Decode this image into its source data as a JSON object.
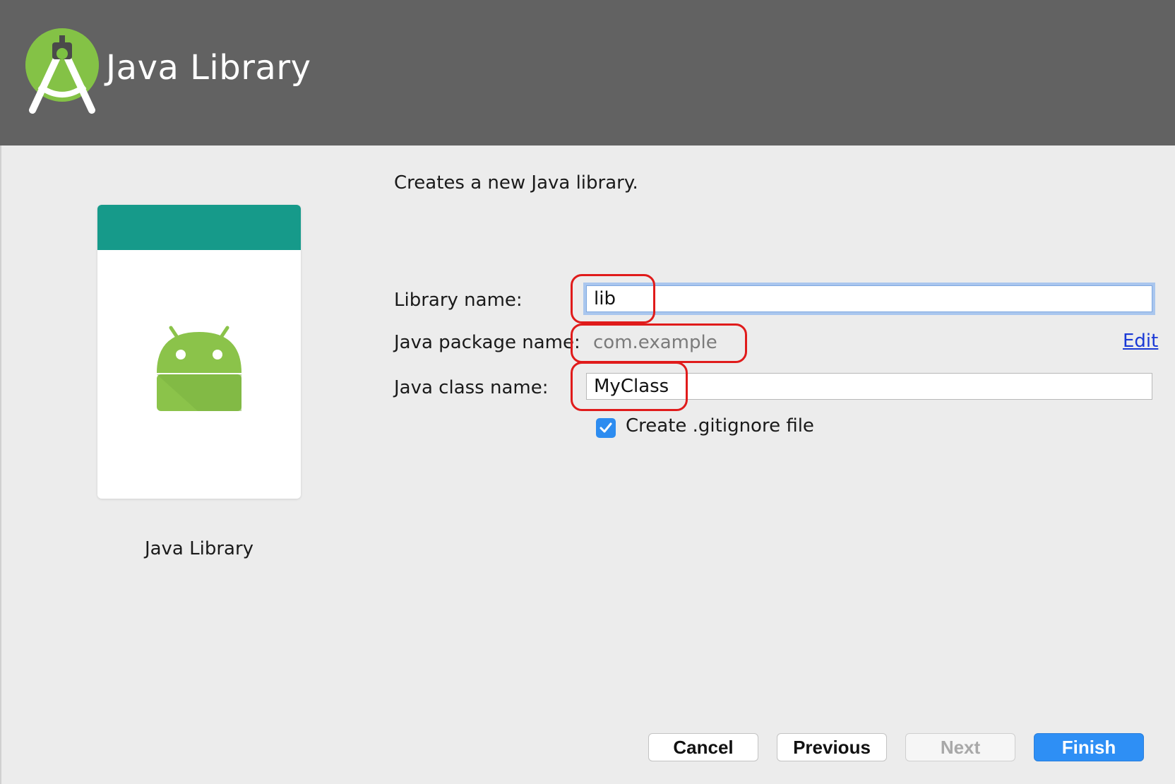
{
  "header": {
    "title": "Java Library",
    "logo_icon": "android-studio-logo-icon"
  },
  "preview": {
    "label": "Java Library",
    "icon": "android-robot-icon",
    "bar_color": "#169a8a"
  },
  "form": {
    "description": "Creates a new Java library.",
    "library_name": {
      "label": "Library name:",
      "value": "lib"
    },
    "package_name": {
      "label": "Java package name:",
      "value": "com.example",
      "edit_label": "Edit"
    },
    "class_name": {
      "label": "Java class name:",
      "value": "MyClass"
    },
    "gitignore": {
      "label": "Create .gitignore file",
      "checked": true
    }
  },
  "buttons": {
    "cancel": "Cancel",
    "previous": "Previous",
    "next": "Next",
    "finish": "Finish"
  },
  "colors": {
    "accent": "#2e8ff5",
    "annotation": "#e01b1b",
    "header_bg": "#626262"
  }
}
